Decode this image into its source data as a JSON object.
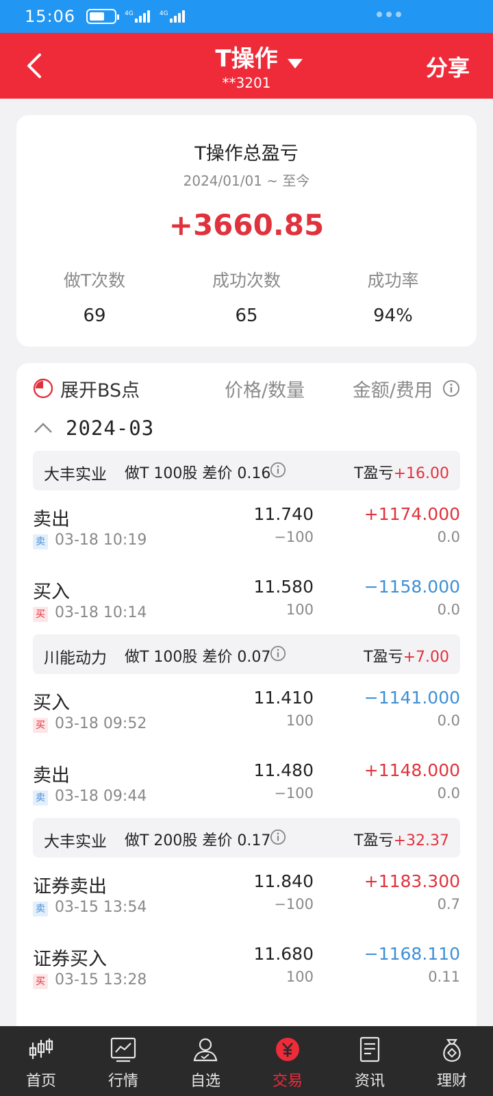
{
  "status_bar": {
    "time": "15:06",
    "network_1": "4G",
    "network_2": "4G"
  },
  "header": {
    "title": "T操作",
    "account": "**3201",
    "share_label": "分享"
  },
  "summary": {
    "title": "T操作总盈亏",
    "date_range": "2024/01/01 ~ 至今",
    "total_pl": "+3660.85",
    "stats": [
      {
        "label": "做T次数",
        "value": "69"
      },
      {
        "label": "成功次数",
        "value": "65"
      },
      {
        "label": "成功率",
        "value": "94%"
      }
    ]
  },
  "list": {
    "expand_label": "展开BS点",
    "col_price": "价格/数量",
    "col_amount": "金额/费用",
    "month": "2024-03",
    "groups": [
      {
        "stock": "大丰实业",
        "desc": "做T 100股 差价 0.16",
        "pl_label": "T盈亏",
        "pl_value": "+16.00",
        "trades": [
          {
            "kind": "卖出",
            "badge": "卖",
            "side": "sell",
            "time": "03-18 10:19",
            "price": "11.740",
            "qty": "−100",
            "amount": "+1174.000",
            "fee": "0.0"
          },
          {
            "kind": "买入",
            "badge": "买",
            "side": "buy",
            "time": "03-18 10:14",
            "price": "11.580",
            "qty": "100",
            "amount": "−1158.000",
            "fee": "0.0"
          }
        ]
      },
      {
        "stock": "川能动力",
        "desc": "做T 100股 差价 0.07",
        "pl_label": "T盈亏",
        "pl_value": "+7.00",
        "trades": [
          {
            "kind": "买入",
            "badge": "买",
            "side": "buy",
            "time": "03-18 09:52",
            "price": "11.410",
            "qty": "100",
            "amount": "−1141.000",
            "fee": "0.0"
          },
          {
            "kind": "卖出",
            "badge": "卖",
            "side": "sell",
            "time": "03-18 09:44",
            "price": "11.480",
            "qty": "−100",
            "amount": "+1148.000",
            "fee": "0.0"
          }
        ]
      },
      {
        "stock": "大丰实业",
        "desc": "做T 200股 差价 0.17",
        "pl_label": "T盈亏",
        "pl_value": "+32.37",
        "trades": [
          {
            "kind": "证券卖出",
            "badge": "卖",
            "side": "sell",
            "time": "03-15 13:54",
            "price": "11.840",
            "qty": "−100",
            "amount": "+1183.300",
            "fee": "0.7"
          },
          {
            "kind": "证券买入",
            "badge": "买",
            "side": "buy",
            "time": "03-15 13:28",
            "price": "11.680",
            "qty": "100",
            "amount": "−1168.110",
            "fee": "0.11"
          }
        ]
      }
    ]
  },
  "tabbar": [
    {
      "label": "首页",
      "icon": "candlestick-icon"
    },
    {
      "label": "行情",
      "icon": "market-chart-icon"
    },
    {
      "label": "自选",
      "icon": "user-check-icon"
    },
    {
      "label": "交易",
      "icon": "yen-icon",
      "active": true
    },
    {
      "label": "资讯",
      "icon": "document-icon"
    },
    {
      "label": "理财",
      "icon": "money-bag-icon"
    }
  ],
  "colors": {
    "brand_red": "#ef2b3a",
    "status_blue": "#2196f3",
    "gain_red": "#e0323c",
    "loss_blue": "#3d8fd6",
    "tabbar_bg": "#2a2a2a"
  }
}
